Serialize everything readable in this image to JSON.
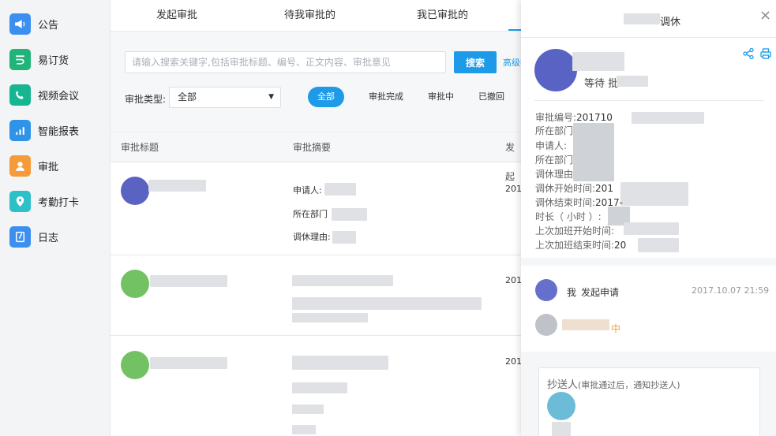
{
  "sidebar": {
    "items": [
      {
        "label": "公告",
        "icon": "megaphone-icon",
        "color": "#3b8ff0"
      },
      {
        "label": "易订货",
        "icon": "order-icon",
        "color": "#20b37a"
      },
      {
        "label": "视频会议",
        "icon": "video-call-icon",
        "color": "#18b591"
      },
      {
        "label": "智能报表",
        "icon": "chart-icon",
        "color": "#2f93e8"
      },
      {
        "label": "审批",
        "icon": "approval-icon",
        "color": "#f59b3a"
      },
      {
        "label": "考勤打卡",
        "icon": "location-icon",
        "color": "#2ec0c9"
      },
      {
        "label": "日志",
        "icon": "log-icon",
        "color": "#3c8fee"
      }
    ]
  },
  "tabs": {
    "items": [
      "发起审批",
      "待我审批的",
      "我已审批的"
    ]
  },
  "filter": {
    "search_placeholder": "请输入搜索关键字,包括审批标题、编号、正文内容、审批意见",
    "search_button": "搜索",
    "advanced_link": "高级搜",
    "type_label": "审批类型:",
    "type_value": "全部",
    "status_pills": [
      "全部",
      "审批完成",
      "审批中",
      "已撤回"
    ]
  },
  "table": {
    "headers": [
      "审批标题",
      "审批摘要",
      "发起"
    ],
    "rows": [
      {
        "summary_lines": [
          "申请人:",
          "所在部门",
          "调休理由:"
        ],
        "date_prefix": "201",
        "avatar_color": "#5a63c2"
      },
      {
        "summary_lines": [
          "",
          "",
          ""
        ],
        "date_prefix": "201",
        "avatar_color": "#72c264"
      },
      {
        "summary_lines": [
          "",
          "",
          ""
        ],
        "date_prefix": "201",
        "avatar_color": "#72c264"
      }
    ]
  },
  "panel": {
    "title": "调休",
    "status": "等待 批",
    "fields": [
      {
        "label": "审批编号:",
        "value": "201710"
      },
      {
        "label": "所在部门:",
        "value": ""
      },
      {
        "label": "申请人:",
        "value": ""
      },
      {
        "label": "所在部门:",
        "value": ""
      },
      {
        "label": "调休理由:",
        "value": ""
      },
      {
        "label": "调休开始时间:",
        "value": "201"
      },
      {
        "label": "调休结束时间:",
        "value": "2017-"
      },
      {
        "label": "时长（ 小时 ）:",
        "value": ""
      },
      {
        "label": "上次加班开始时间:",
        "value": ""
      },
      {
        "label": "上次加班结束时间:",
        "value": "20"
      }
    ],
    "flow": {
      "initiator_name": "我",
      "initiator_action": "发起申请",
      "initiator_time": "2017.10.07 21:59",
      "pending_suffix": "中"
    },
    "cc": {
      "title": "抄送人",
      "note": "(审批通过后，通知抄送人)"
    }
  },
  "colors": {
    "accent": "#1e9be8",
    "pending_orange": "#f0a03c"
  }
}
